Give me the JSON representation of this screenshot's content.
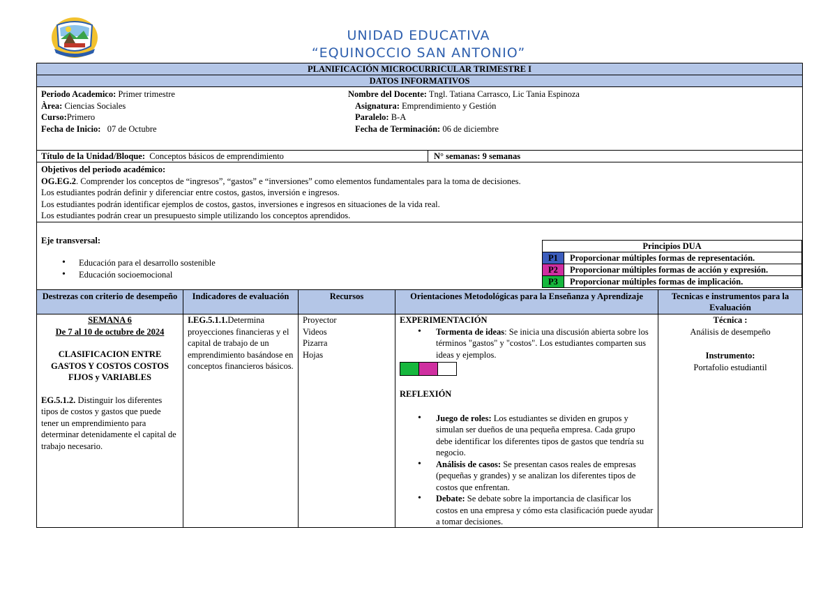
{
  "header": {
    "line1": "UNIDAD EDUCATIVA",
    "line2": "“EQUINOCCIO SAN ANTONIO”"
  },
  "bands": {
    "plan": "PLANIFICACIÓN MICROCURRICULAR TRIMESTRE I",
    "datos": "DATOS INFORMATIVOS"
  },
  "info": {
    "periodo_label": "Periodo Academico:",
    "periodo_value": " Primer trimestre",
    "area_label": "Àrea:",
    "area_value": " Ciencias Sociales",
    "curso_label": "Curso:",
    "curso_value": "Primero",
    "inicio_label": "Fecha de Inicio:",
    "inicio_value": "   07 de Octubre",
    "docente_label": "Nombre del Docente:",
    "docente_value": " Tngl. Tatiana Carrasco, Lic Tania Espinoza",
    "asignatura_label": "Asignatura:",
    "asignatura_value": " Emprendimiento y Gestión",
    "paralelo_label": "Paralelo:",
    "paralelo_value": " B-A",
    "termino_label": "Fecha de Terminación:",
    "termino_value": " 06 de diciembre"
  },
  "unidad": {
    "label": "Título de la Unidad/Bloque:",
    "value": "  Conceptos básicos de emprendimiento",
    "semanas": "N° semanas:  9 semanas"
  },
  "objetivos": {
    "heading": "Objetivos del periodo académico:",
    "og_code": "OG.EG.2",
    "og_text": ". Comprender los conceptos de “ingresos”, “gastos” e “inversiones” como elementos fundamentales para la toma de decisiones.",
    "lines": [
      "Los estudiantes podrán definir y diferenciar entre costos, gastos, inversión e ingresos.",
      "Los estudiantes podrán identificar ejemplos de costos, gastos, inversiones e ingresos en situaciones de la vida real.",
      "Los estudiantes podrán crear un presupuesto simple utilizando los conceptos aprendidos."
    ]
  },
  "eje": {
    "label": "Eje transversal:",
    "items": [
      "Educación para el desarrollo sostenible",
      "Educación socioemocional"
    ]
  },
  "dua": {
    "title": "Principios DUA",
    "rows": [
      {
        "tag": "P1",
        "text": "Proporcionar múltiples formas de representación.",
        "color": "#3c5dbd"
      },
      {
        "tag": "P2",
        "text": "Proporcionar múltiples formas de acción y expresión.",
        "color": "#cf2fa0"
      },
      {
        "tag": "P3",
        "text": "Proporcionar múltiples formas de implicación.",
        "color": "#16b73d"
      }
    ]
  },
  "table": {
    "headers": [
      "Destrezas con criterio de desempeño",
      "Indicadores de evaluación",
      "Recursos",
      "Orientaciones Metodológicas para la Enseñanza y Aprendizaje",
      "Tecnicas e instrumentos para la Evaluación"
    ],
    "col1": {
      "semana": "SEMANA 6",
      "fecha": "De 7 al 10 de octubre de 2024",
      "tema": "CLASIFICACION ENTRE GASTOS Y COSTOS COSTOS FIJOS y VARIABLES",
      "eg_code": "EG.5.1.2.",
      "eg_text": " Distinguir los diferentes tipos de costos y gastos que puede tener un emprendimiento para determinar detenidamente el capital de trabajo necesario."
    },
    "col2": {
      "code": "I.EG.5.1.1.",
      "text": "Determina proyecciones financieras y el capital de trabajo de un emprendimiento basándose en conceptos financieros básicos."
    },
    "col3": {
      "items": [
        "Proyector",
        "Videos",
        "Pizarra",
        "Hojas"
      ]
    },
    "col4": {
      "exp_title": "EXPERIMENTACIÓN",
      "exp_bold": "Tormenta de ideas",
      "exp_text": ": Se inicia una discusión abierta sobre los términos \"gastos\" y \"costos\". Los estudiantes comparten sus ideas y ejemplos.",
      "swatches": [
        "#16b73d",
        "#cf2fa0",
        "#ffffff"
      ],
      "ref_title": "REFLEXIÓN",
      "ref_items": [
        {
          "bold": "Juego de roles:",
          "text": " Los estudiantes se dividen en grupos y simulan ser dueños de una pequeña empresa. Cada grupo debe identificar los diferentes tipos de gastos que tendría su negocio."
        },
        {
          "bold": "Análisis de casos:",
          "text": " Se presentan casos reales de empresas (pequeñas y grandes) y se analizan los diferentes tipos de costos que enfrentan."
        },
        {
          "bold": "Debate:",
          "text": " Se debate sobre la importancia de clasificar los costos en una empresa y cómo esta clasificación puede ayudar a tomar decisiones."
        }
      ]
    },
    "col5": {
      "tec_label": "Técnica :",
      "tec_value": "Análisis de desempeño",
      "inst_label": "Instrumento:",
      "inst_value": "Portafolio estudiantil"
    }
  }
}
